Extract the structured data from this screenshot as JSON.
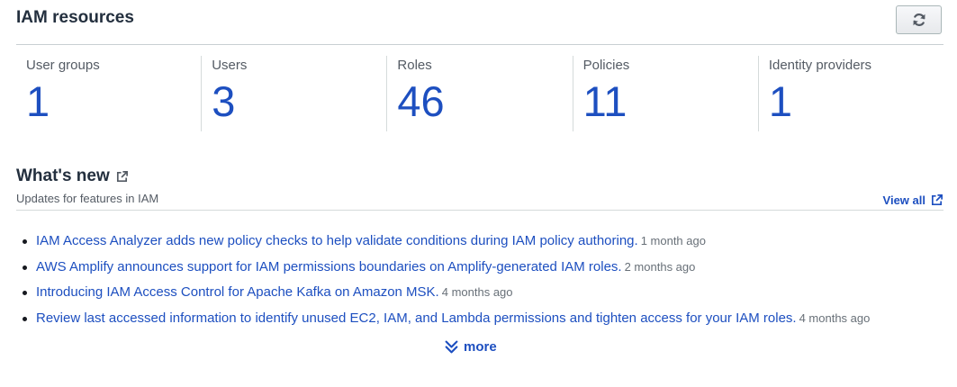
{
  "resources": {
    "title": "IAM resources",
    "refresh_icon": "refresh-icon",
    "stats": [
      {
        "label": "User groups",
        "value": "1"
      },
      {
        "label": "Users",
        "value": "3"
      },
      {
        "label": "Roles",
        "value": "46"
      },
      {
        "label": "Policies",
        "value": "11"
      },
      {
        "label": "Identity providers",
        "value": "1"
      }
    ]
  },
  "whats_new": {
    "title": "What's new",
    "subtitle": "Updates for features in IAM",
    "view_all": "View all",
    "items": [
      {
        "text": "IAM Access Analyzer adds new policy checks to help validate conditions during IAM policy authoring.",
        "ago": "1 month ago"
      },
      {
        "text": "AWS Amplify announces support for IAM permissions boundaries on Amplify-generated IAM roles.",
        "ago": "2 months ago"
      },
      {
        "text": "Introducing IAM Access Control for Apache Kafka on Amazon MSK.",
        "ago": "4 months ago"
      },
      {
        "text": "Review last accessed information to identify unused EC2, IAM, and Lambda permissions and tighten access for your IAM roles.",
        "ago": "4 months ago"
      }
    ],
    "more": "more"
  },
  "colors": {
    "link": "#1d4fc0",
    "title": "#232f3e",
    "muted": "#545b64"
  }
}
